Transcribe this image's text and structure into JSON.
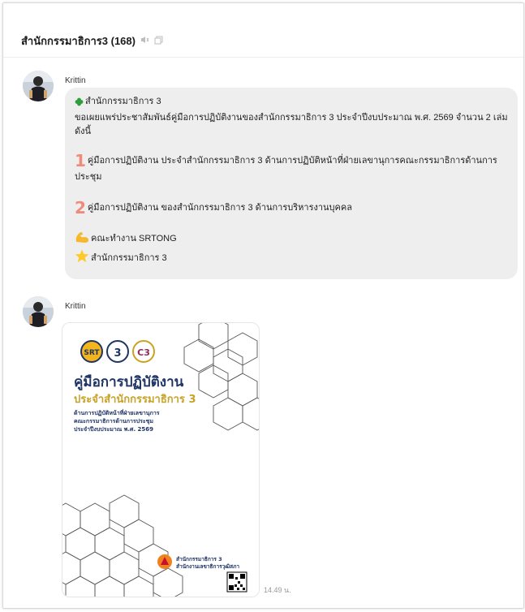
{
  "header": {
    "title": "สำนักกรรมาธิการ3 (168)",
    "mute_icon": "speaker-mute-icon",
    "copy_icon": "copy-icon"
  },
  "messages": [
    {
      "sender": "Krittin",
      "lines": {
        "greeting": "สำนักกรรมาธิการ 3",
        "intro": "ขอเผยแพร่ประชาสัมพันธ์คู่มือการปฏิบัติงานของสำนักกรรมาธิการ 3 ประจำปีงบประมาณ พ.ศ. 2569 จำนวน 2 เล่ม ดังนี้",
        "item1": "คู่มือการปฏิบัติงาน ประจำสำนักกรรมาธิการ 3 ด้านการปฏิบัติหน้าที่ฝ่ายเลขานุการคณะกรรมาธิการด้านการประชุม",
        "item2": "คู่มือการปฏิบัติงาน ของสำนักกรรมาธิการ 3 ด้านการบริหารงานบุคคล",
        "team": "คณะทำงาน SRTONG",
        "office": "สำนักกรรมาธิการ 3"
      },
      "icons": [
        "green-clover-icon",
        "keycap-1-icon",
        "keycap-2-icon",
        "flexed-biceps-icon",
        "star-icon"
      ]
    },
    {
      "sender": "Krittin",
      "image": {
        "logo1_text": "SRT",
        "logo2_text": "3",
        "logo3_text": "C3",
        "title": "คู่มือการปฏิบัติงาน",
        "subtitle": "ประจำสำนักกรรมาธิการ 3",
        "desc": [
          "ด้านการปฏิบัติหน้าที่ฝ่ายเลขานุการ",
          "คณะกรรมาธิการด้านการประชุม",
          "ประจำปีงบประมาณ พ.ศ. 2569"
        ],
        "footer": [
          "สำนักกรรมาธิการ 3",
          "สำนักงานเลขาธิการวุฒิสภา"
        ]
      },
      "time": "14.49 น."
    }
  ],
  "colors": {
    "navy": "#1f3566",
    "gold": "#c9a227",
    "bubble": "#eeeeee",
    "keycap": "#f4a9a0",
    "keycap_text": "#e0654f"
  }
}
